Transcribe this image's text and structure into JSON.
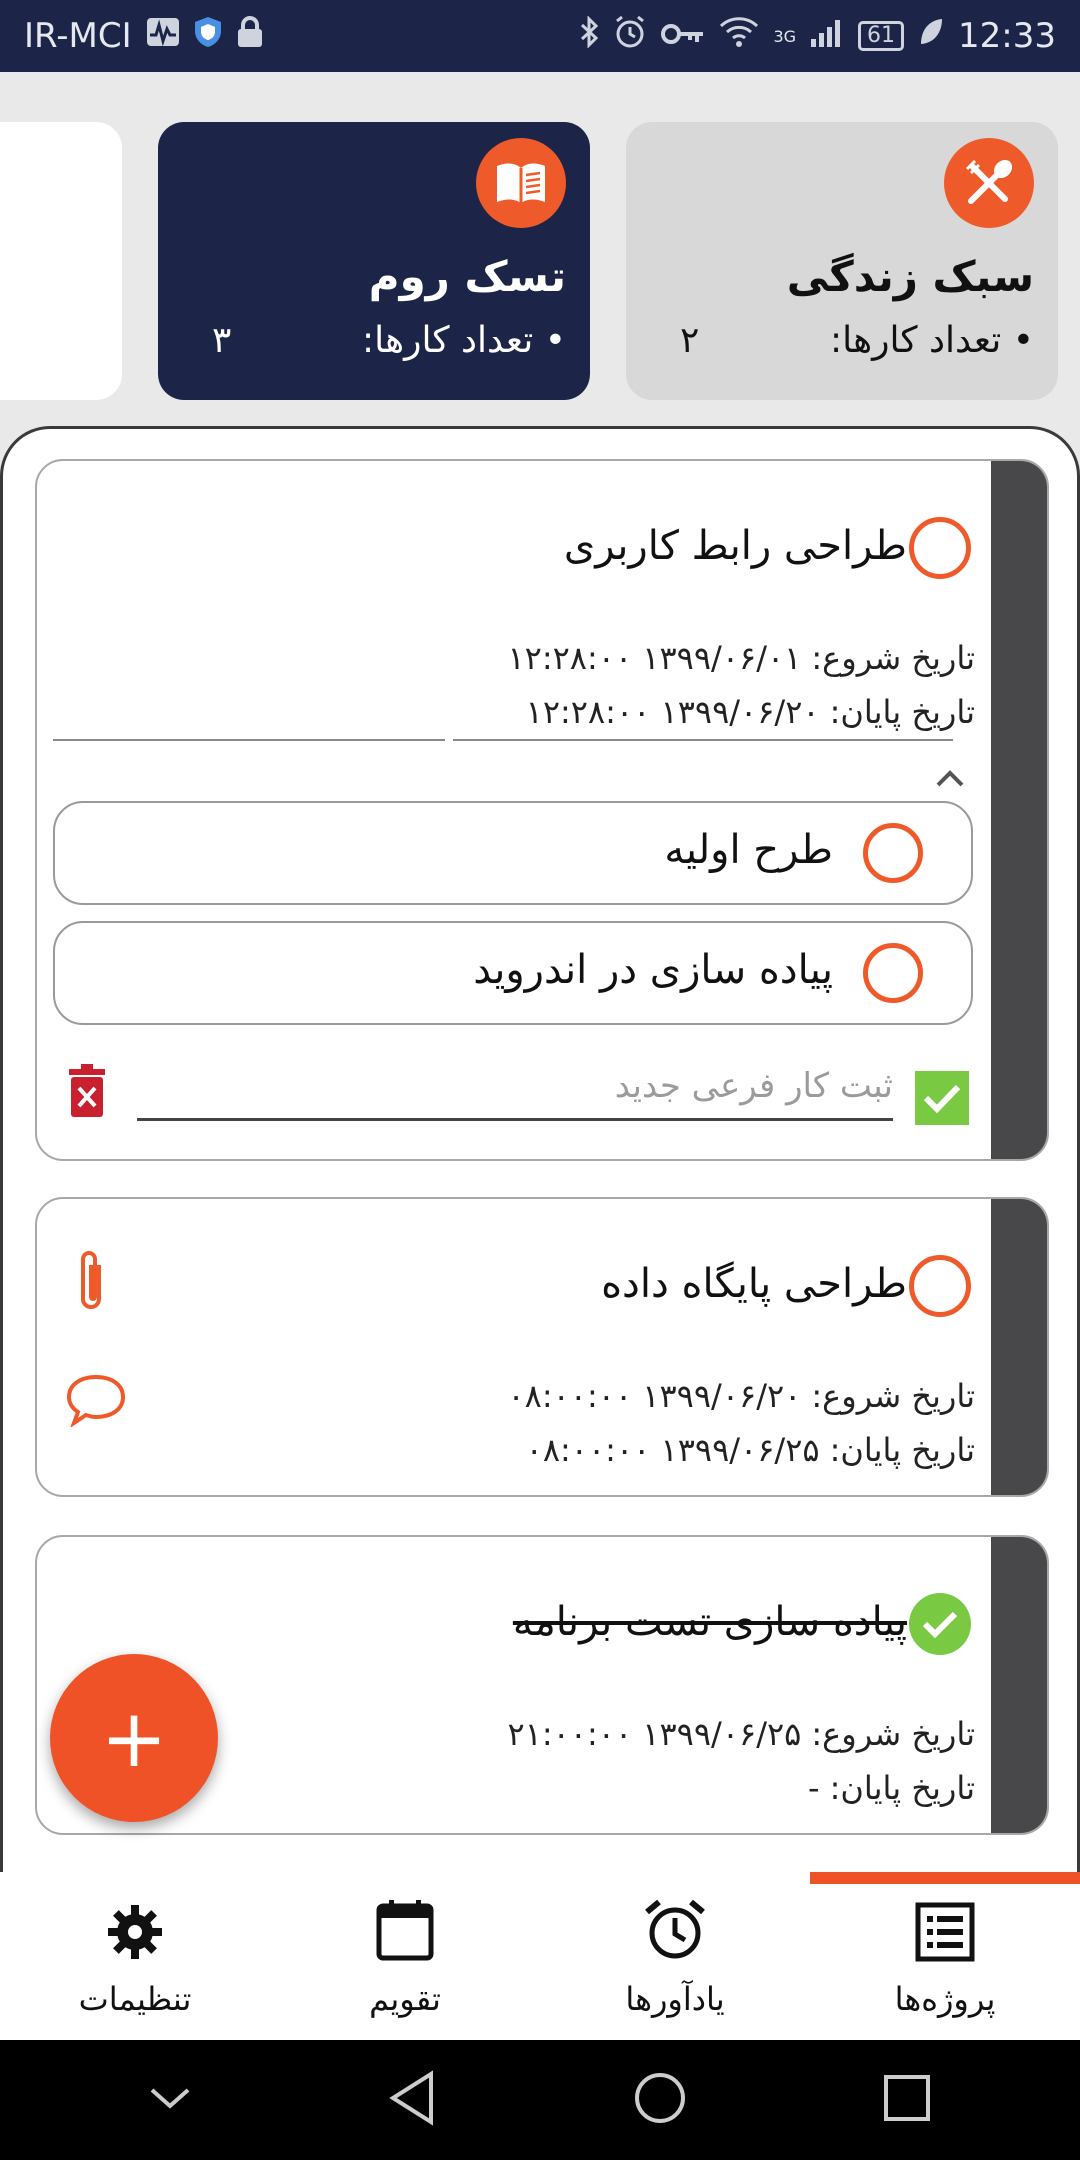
{
  "status_bar": {
    "carrier": "IR-MCI",
    "network": "3G",
    "battery": "61",
    "time": "12:33"
  },
  "projects": [
    {
      "title": "تسک روم",
      "count_label": "• تعداد کارها:",
      "count": "۳",
      "icon": "book-icon",
      "bg": "#1c2548"
    },
    {
      "title": "سبک زندگی",
      "count_label": "• تعداد کارها:",
      "count": "۲",
      "icon": "fork-spoon-icon",
      "bg": "#d8d8d8"
    }
  ],
  "tasks": [
    {
      "title": "طراحی رابط کاربری",
      "start_label": "تاریخ شروع:",
      "start": "۱۳۹۹/۰۶/۰۱ ۱۲:۲۸:۰۰",
      "end_label": "تاریخ پایان:",
      "end": "۱۳۹۹/۰۶/۲۰ ۱۲:۲۸:۰۰",
      "subtasks": [
        "طرح اولیه",
        "پیاده سازی در اندروید"
      ],
      "new_subtask_placeholder": "ثبت کار فرعی جدید"
    },
    {
      "title": "طراحی پایگاه داده",
      "start_label": "تاریخ شروع:",
      "start": "۱۳۹۹/۰۶/۲۰ ۰۸:۰۰:۰۰",
      "end_label": "تاریخ پایان:",
      "end": "۱۳۹۹/۰۶/۲۵ ۰۸:۰۰:۰۰"
    },
    {
      "title": "پیاده سازی تست برنامه",
      "start_label": "تاریخ شروع:",
      "start": "۱۳۹۹/۰۶/۲۵ ۲۱:۰۰:۰۰",
      "end_label": "تاریخ پایان:",
      "end": "-",
      "done": true
    }
  ],
  "fab_label": "+",
  "bottom_nav": [
    {
      "label": "تنظیمات",
      "icon": "gear-icon"
    },
    {
      "label": "تقویم",
      "icon": "calendar-icon"
    },
    {
      "label": "یادآورها",
      "icon": "alarm-clock-icon"
    },
    {
      "label": "پروژه‌ها",
      "icon": "list-icon",
      "active": true
    }
  ],
  "colors": {
    "accent": "#ef5a2b",
    "navy": "#1c2548",
    "done_green": "#7ac943",
    "trash_red": "#c8202f"
  }
}
